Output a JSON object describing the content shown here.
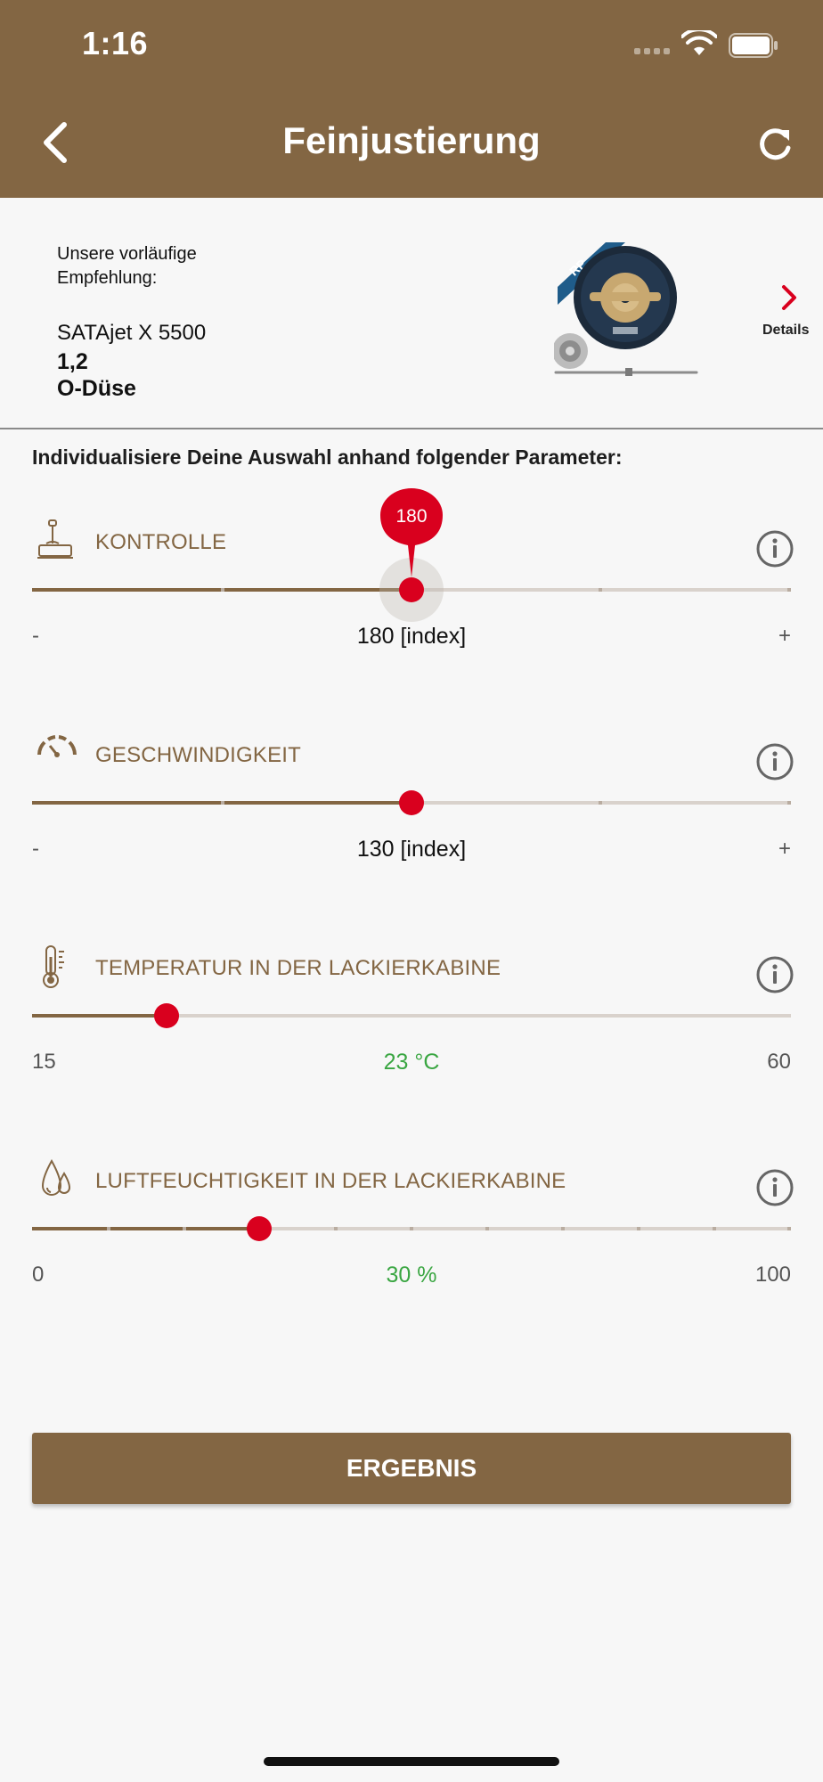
{
  "status_bar": {
    "time": "1:16"
  },
  "header": {
    "title": "Feinjustierung"
  },
  "recommendation": {
    "label": "Unsere vorläufige Empfehlung:",
    "product_name": "SATAjet X 5500",
    "nozzle_size": "1,2",
    "nozzle_type": "O-Düse",
    "details_label": "Details",
    "image_badge": "RP"
  },
  "intro_text": "Individualisiere Deine Auswahl anhand folgender Parameter:",
  "parameters": [
    {
      "label": "KONTROLLE",
      "min_label": "-",
      "max_label": "+",
      "value_label": "180 [index]",
      "bubble": "180",
      "slider_fraction": 0.5,
      "icon": "control-stamp-icon"
    },
    {
      "label": "GESCHWINDIGKEIT",
      "min_label": "-",
      "max_label": "+",
      "value_label": "130 [index]",
      "slider_fraction": 0.5,
      "icon": "speedometer-icon"
    },
    {
      "label": "TEMPERATUR IN DER LACKIERKABINE",
      "min_label": "15",
      "max_label": "60",
      "value_label": "23 °C",
      "slider_fraction": 0.178,
      "icon": "thermometer-icon"
    },
    {
      "label": "LUFTFEUCHTIGKEIT IN DER LACKIERKABINE",
      "min_label": "0",
      "max_label": "100",
      "value_label": "30 %",
      "slider_fraction": 0.3,
      "icon": "droplets-icon"
    }
  ],
  "result_button": "ERGEBNIS",
  "colors": {
    "brand": "#836643",
    "accent": "#d9001e",
    "positive": "#3aa642"
  }
}
